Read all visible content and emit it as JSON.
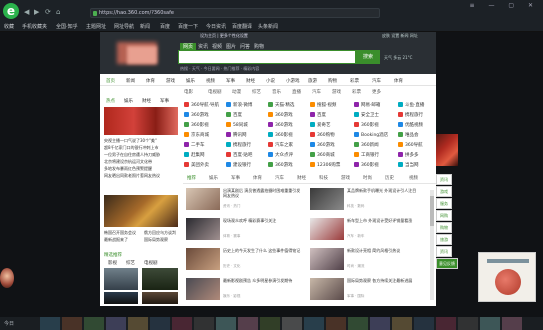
{
  "browser": {
    "logo_letter": "e",
    "url": "https://hao.360.com/?360safe",
    "bookmarks": [
      "收藏",
      "手机收藏夹",
      "全国·知乎",
      "主题网址",
      "网址导航",
      "新闻",
      "百度",
      "百度一下",
      "今日资讯",
      "百度翻译",
      "头条新闻"
    ],
    "window_controls": "≡ — ▢ ✕"
  },
  "header": {
    "top_note": "设为主页 | 更多个性化设置",
    "top_right": "皮肤  设置  新闻  网址",
    "search_tabs": [
      "网页",
      "资讯",
      "视频",
      "图片",
      "问答",
      "购物"
    ],
    "search_button": "搜索",
    "hot_words": "热搜 · 天气 · 今日要闻 · 热门推荐 · 精彩内容",
    "side_note": "天气 多云 21°C"
  },
  "category_nav": [
    "首页",
    "新闻",
    "体育",
    "游戏",
    "娱乐",
    "视频",
    "军事",
    "财经",
    "小说",
    "小游戏",
    "旅游",
    "购物",
    "彩票",
    "汽车",
    "体育"
  ],
  "category_nav2": [
    "电影",
    "电视剧",
    "动漫",
    "综艺",
    "音乐",
    "直播",
    "汽车",
    "游戏",
    "彩票",
    "更多"
  ],
  "left_column": {
    "tabs": [
      "热点",
      "娱乐",
      "财经",
      "军事"
    ],
    "lines": [
      "央视主播一口气说了30个\"美\"",
      "超8千亿家门口的银行冲刺上市",
      "一位男子在自住房遭人持刀威胁",
      "北京将建设京杭运河文化带",
      "多地发布暴雨红色预警提醒",
      "网友晒出同款老照片惹网友热议"
    ],
    "lines2": [
      "韩国召开国务会议",
      "俄方回应乌方谈判",
      "最新战报来了",
      "国际局势观察"
    ],
    "bottom_tabs": [
      "精选推荐",
      "影视",
      "综艺",
      "电视剧"
    ]
  },
  "link_grid": {
    "rows": [
      [
        "360导航·导航",
        "新浪·微博",
        "天猫·精选",
        "搜狐·视频",
        "网易·邮箱",
        "斗鱼·直播"
      ],
      [
        "360游戏",
        "百度",
        "360游戏",
        "百度",
        "安全卫士",
        "携程旅行"
      ],
      [
        "360影视",
        "58同城",
        "360游戏",
        "爱奇艺",
        "360影视",
        "优酷视频"
      ],
      [
        "京东商城",
        "腾讯网",
        "360影视",
        "360购物",
        "Booking酒店",
        "唯品会"
      ],
      [
        "二手车",
        "携程旅行",
        "汽车之家",
        "360游戏",
        "360新闻",
        "360导航"
      ],
      [
        "赶集网",
        "百度·贴吧",
        "大众点评",
        "360商城",
        "工商银行",
        "拼多多"
      ],
      [
        "美团外卖",
        "建设银行",
        "360游戏",
        "12306购票",
        "360影视",
        "当当网"
      ]
    ]
  },
  "feed": {
    "tabs": [
      "推荐",
      "娱乐",
      "军事",
      "体育",
      "汽车",
      "财经",
      "科技",
      "游戏",
      "时尚",
      "历史",
      "视频"
    ],
    "items": [
      {
        "title": "出演某剧后 演员曾透露拍摄时困难重重引发网友热议",
        "source": "资讯 · 热门"
      },
      {
        "title": "某品牌新款手机曝光 外观设计引人注目",
        "source": "科技 · 数码"
      },
      {
        "title": "现场观众欢呼 精彩赛事引关注",
        "source": "体育 · 赛事"
      },
      {
        "title": "新车型上市 外观设计受好评销量看涨",
        "source": "汽车 · 新车"
      },
      {
        "title": "历史上的今天发生了什么 这些事件值得铭记",
        "source": "历史 · 文化"
      },
      {
        "title": "新款设计亮相 简约风格引热议",
        "source": "时尚 · 潮流"
      },
      {
        "title": "最新影视剧预告 众多明星参演引发期待",
        "source": "娱乐 · 影视"
      },
      {
        "title": "国际局势观察 各方持续关注最新进展",
        "source": "军事 · 国际"
      }
    ]
  },
  "right_sidebar": [
    "资讯",
    "游戏",
    "服务",
    "网购",
    "购物",
    "旅游",
    "资讯",
    "意见反馈"
  ],
  "taskbar": {
    "left_label": "今日"
  }
}
